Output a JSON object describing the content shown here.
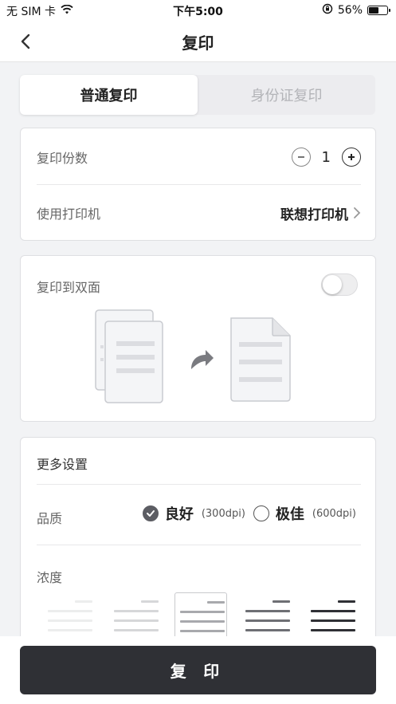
{
  "status_bar": {
    "carrier": "无 SIM 卡",
    "time": "下午5:00",
    "battery_percent": "56%",
    "battery_level": 0.56,
    "icons": [
      "wifi-icon",
      "orientation-lock-icon",
      "battery-icon"
    ]
  },
  "nav": {
    "title": "复印",
    "back_icon": "chevron-left-icon"
  },
  "tabs": [
    {
      "label": "普通复印",
      "active": true
    },
    {
      "label": "身份证复印",
      "active": false
    }
  ],
  "copies": {
    "label": "复印份数",
    "value": "1",
    "minus_icon": "minus-circle-icon",
    "plus_icon": "plus-circle-icon"
  },
  "printer": {
    "label": "使用打印机",
    "value": "联想打印机",
    "chevron_icon": "chevron-right-icon"
  },
  "duplex": {
    "label": "复印到双面",
    "enabled": false,
    "illustration_icons": [
      "two-sided-documents-icon",
      "curved-arrow-icon",
      "single-document-icon"
    ]
  },
  "more_settings": {
    "title": "更多设置",
    "quality": {
      "label": "品质",
      "options": [
        {
          "name": "良好",
          "dpi": "(300dpi)",
          "selected": true
        },
        {
          "name": "极佳",
          "dpi": "(600dpi)",
          "selected": false
        }
      ]
    },
    "density": {
      "label": "浓度",
      "levels": 5,
      "selected_index": 2
    }
  },
  "action": {
    "copy_button_label": "复 印"
  },
  "colors": {
    "primary_button": "#2f3035",
    "background": "#f2f3f5",
    "radio_checked": "#5c5d63"
  }
}
